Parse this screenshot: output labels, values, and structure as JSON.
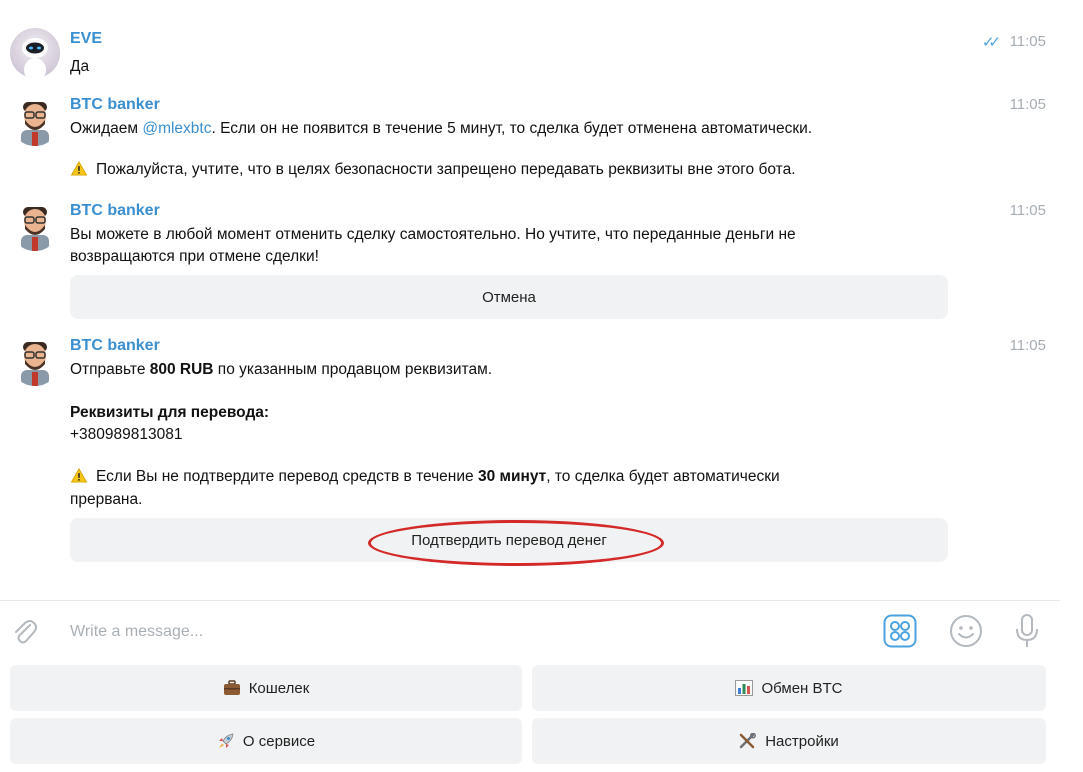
{
  "messages": [
    {
      "sender": "EVE",
      "time": "11:05",
      "read_checks": "✓✓",
      "lines": [
        "Да"
      ]
    },
    {
      "sender": "BTC banker",
      "time": "11:05",
      "line1_pre": "Ожидаем ",
      "line1_mention": "@mlexbtc",
      "line1_post": ". Если он не появится в течение 5 минут, то сделка будет отменена автоматически.",
      "line2": "Пожалуйста, учтите, что в целях безопасности запрещено передавать реквизиты вне этого бота."
    },
    {
      "sender": "BTC banker",
      "time": "11:05",
      "line1": "Вы можете в любой момент отменить сделку самостоятельно. Но учтите, что переданные деньги не",
      "line2": "возвращаются при отмене сделки!",
      "button": "Отмена"
    },
    {
      "sender": "BTC banker",
      "time": "11:05",
      "line1_pre": "Отправьте ",
      "line1_bold": "800 RUB",
      "line1_post": " по указанным продавцом реквизитам.",
      "details_title": "Реквизиты для перевода:",
      "details_value": "+380989813081",
      "warn_pre": "Если Вы не подтвердите перевод средств в течение ",
      "warn_bold": "30 минут",
      "warn_post": ", то сделка будет автоматически",
      "warn_line2": "прервана.",
      "button": "Подтвердить перевод денег"
    }
  ],
  "composer": {
    "placeholder": "Write a message..."
  },
  "keyboard": {
    "wallet": "Кошелек",
    "exchange": "Обмен BTC",
    "about": "О сервисе",
    "settings": "Настройки"
  },
  "colors": {
    "accent": "#3a8fd0",
    "highlight_circle": "#d42929",
    "button_bg": "#f1f2f3",
    "time": "#a6adb4"
  },
  "icons": [
    "paperclip-icon",
    "bot-keyboard-icon",
    "emoji-icon",
    "microphone-icon",
    "warning-icon",
    "briefcase-icon",
    "chart-icon",
    "rocket-icon",
    "tools-icon"
  ]
}
